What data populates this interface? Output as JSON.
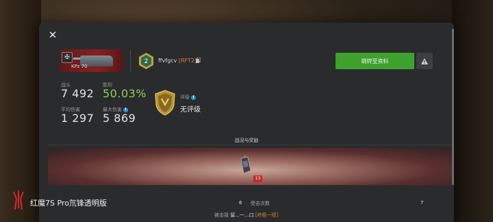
{
  "colors": {
    "accent_green": "#3ea12b",
    "win_rate_green": "#8fd15d",
    "clan_orange": "#d7862b",
    "level_red": "#c62b2b",
    "info_blue": "#2f8fd6",
    "panel_bg": "#2a2b2d"
  },
  "header": {
    "close_icon": "close-icon",
    "tank_label": "KPz 70",
    "rank_number": "2",
    "player_name": "ffvfgcv",
    "clan_tag": "[RFT2]",
    "goto_button": "跳转至资料",
    "warn_icon": "warning-triangle-icon"
  },
  "stats": {
    "battles_label": "战斗",
    "battles_value": "7 492",
    "win_label": "胜利",
    "win_value": "50.03%",
    "avg_dmg_label": "平均伤害",
    "avg_dmg_value": "1 297",
    "max_dmg_label": "最大伤害",
    "max_dmg_value": "5 869",
    "rating_label": "评级",
    "rating_value": "无评级"
  },
  "battle": {
    "section_title": "战况与奖励",
    "vehicle_level": "13",
    "left_number": "6",
    "hits_label": "受击次数",
    "right_number": "7",
    "killed_by_label": "被击毁",
    "killed_by_player": "留...一...口",
    "killed_by_clan": "[终极一班]"
  },
  "watermark": {
    "model": "红魔7S Pro氘锋透明版"
  }
}
